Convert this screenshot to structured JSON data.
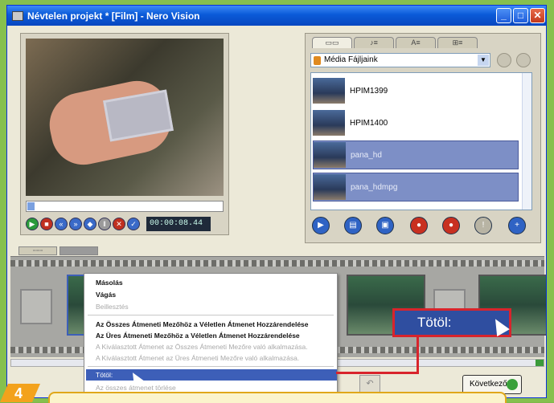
{
  "window": {
    "title": "Névtelen projekt * [Film] - Nero Vision",
    "min": "_",
    "max": "□",
    "close": "✕"
  },
  "player": {
    "timecode": "00:00:08.44"
  },
  "media": {
    "selector": "Média Fájljaink",
    "tabs": [
      "▭▭",
      "♪≡",
      "A≡",
      "⊞≡"
    ],
    "files": [
      {
        "name": "HPIM1399",
        "selected": false
      },
      {
        "name": "HPIM1400",
        "selected": false
      },
      {
        "name": "pana_hd",
        "selected": true
      },
      {
        "name": "pana_hdmpg",
        "selected": true
      }
    ]
  },
  "context_menu": {
    "items": [
      {
        "label": "Másolás",
        "state": "bold"
      },
      {
        "label": "Vágás",
        "state": "bold"
      },
      {
        "label": "Beillesztés",
        "state": "disabled"
      },
      {
        "label": "Az Összes Átmeneti Mezőhöz a Véletlen Átmenet Hozzárendelése",
        "state": "bold"
      },
      {
        "label": "Az Üres Átmeneti Mezőhöz a Véletlen Átmenet Hozzárendelése",
        "state": "bold"
      },
      {
        "label": "A Kiválasztott Átmenet az Összes Átmeneti Mezőre való alkalmazása.",
        "state": "disabled"
      },
      {
        "label": "A Kiválasztott Átmenet az Üres Átmeneti Mezőre való alkalmazása.",
        "state": "disabled"
      },
      {
        "label": "Tötöl:",
        "state": "highlighted"
      },
      {
        "label": "Az összes átmenet törlése",
        "state": "disabled"
      }
    ]
  },
  "zoom_callout": {
    "label": "Tötöl:"
  },
  "bottom": {
    "next_label": "Következő",
    "undo": "↶"
  },
  "step": {
    "number": "4"
  },
  "colors": {
    "accent_red": "#d8242c",
    "selection_blue": "#3d5fb8",
    "step_orange": "#f3a21c"
  }
}
